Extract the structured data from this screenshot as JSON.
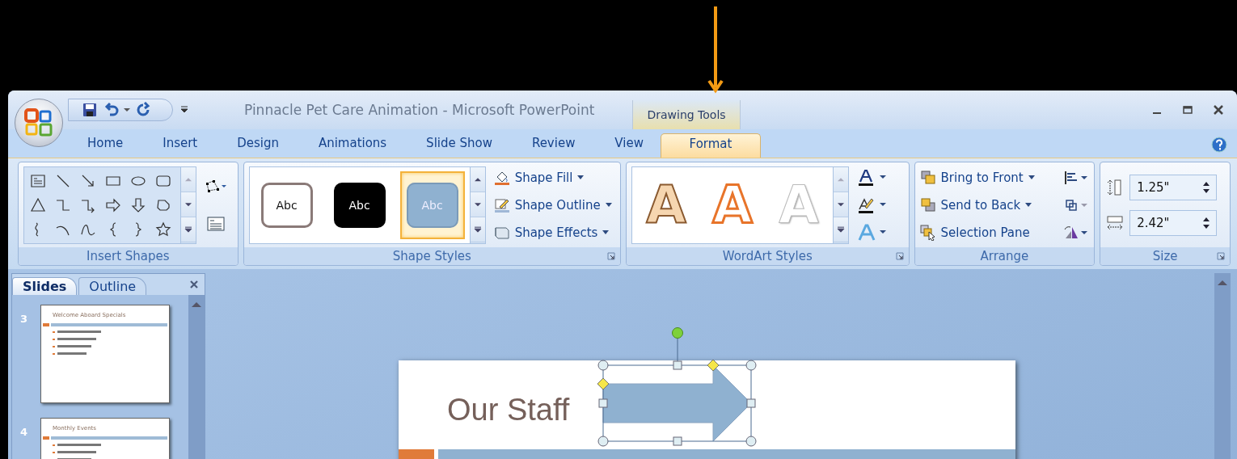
{
  "window": {
    "title": "Pinnacle Pet Care Animation - Microsoft PowerPoint"
  },
  "contextual_group": {
    "label": "Drawing Tools"
  },
  "tabs": [
    {
      "label": "Home",
      "selected": false,
      "contextual": false
    },
    {
      "label": "Insert",
      "selected": false,
      "contextual": false
    },
    {
      "label": "Design",
      "selected": false,
      "contextual": false
    },
    {
      "label": "Animations",
      "selected": false,
      "contextual": false
    },
    {
      "label": "Slide Show",
      "selected": false,
      "contextual": false
    },
    {
      "label": "Review",
      "selected": false,
      "contextual": false
    },
    {
      "label": "View",
      "selected": false,
      "contextual": false
    },
    {
      "label": "Format",
      "selected": true,
      "contextual": true
    }
  ],
  "ribbon": {
    "groups": [
      {
        "kind": "insert_shapes",
        "label": "Insert Shapes",
        "launcher": false
      },
      {
        "kind": "shape_styles",
        "label": "Shape Styles",
        "launcher": true,
        "styles": [
          {
            "kind": "outline",
            "text": "Abc",
            "selected": false
          },
          {
            "kind": "dark",
            "text": "Abc",
            "selected": false
          },
          {
            "kind": "accent",
            "text": "Abc",
            "selected": true
          }
        ],
        "commands": [
          {
            "kind": "fill",
            "label": "Shape Fill"
          },
          {
            "kind": "outline",
            "label": "Shape Outline"
          },
          {
            "kind": "effects",
            "label": "Shape Effects"
          }
        ]
      },
      {
        "kind": "wordart_styles",
        "label": "WordArt Styles",
        "launcher": true,
        "styles": [
          {
            "kind": "tan",
            "text": "A",
            "selected": false
          },
          {
            "kind": "orange",
            "text": "A",
            "selected": false
          },
          {
            "kind": "white",
            "text": "A",
            "selected": false
          }
        ]
      },
      {
        "kind": "arrange",
        "label": "Arrange",
        "launcher": false,
        "commands": [
          {
            "kind": "front",
            "label": "Bring to Front",
            "dropdown": true
          },
          {
            "kind": "back",
            "label": "Send to Back",
            "dropdown": true
          },
          {
            "kind": "pane",
            "label": "Selection Pane",
            "dropdown": false
          }
        ]
      },
      {
        "kind": "size",
        "label": "Size",
        "launcher": true,
        "fields": [
          {
            "kind": "height",
            "value": "1.25\""
          },
          {
            "kind": "width",
            "value": "2.42\""
          }
        ]
      }
    ]
  },
  "pane": {
    "tabs": [
      {
        "label": "Slides",
        "selected": true
      },
      {
        "label": "Outline",
        "selected": false
      }
    ],
    "thumbnails": [
      {
        "number": "3",
        "title": "Welcome Aboard Specials"
      },
      {
        "number": "4",
        "title": "Monthly Events"
      }
    ]
  },
  "slide": {
    "title": "Our Staff",
    "shape_selected": true
  }
}
